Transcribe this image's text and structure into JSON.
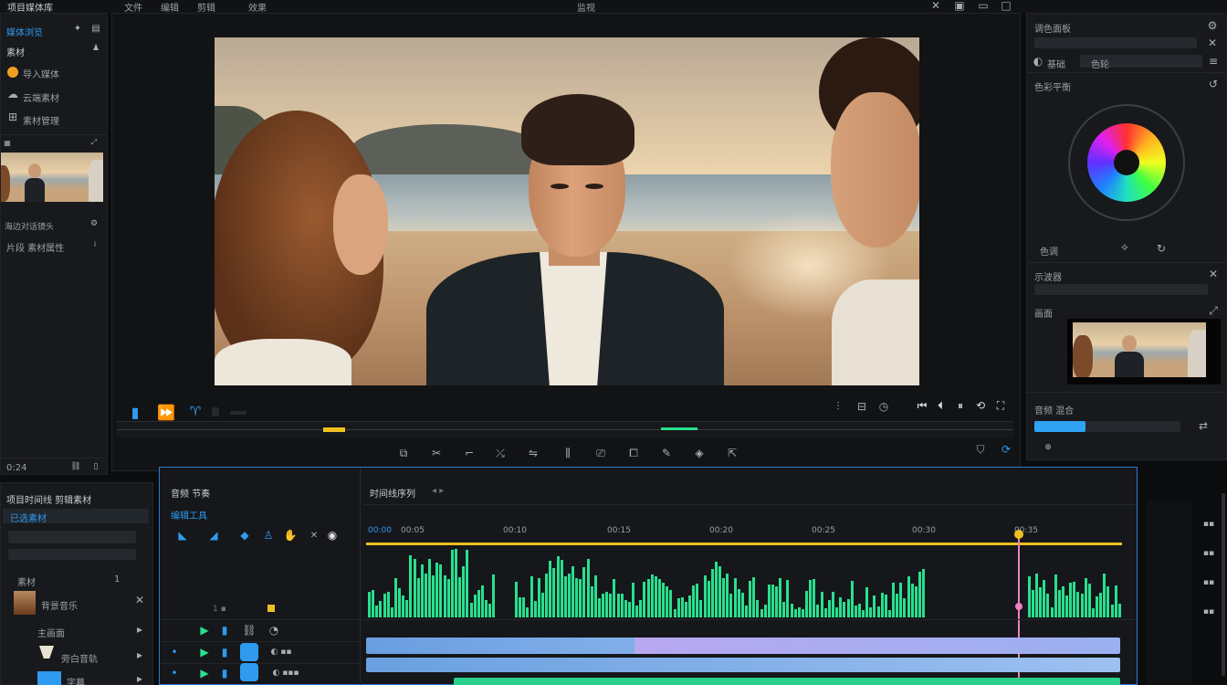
{
  "top_menu": {
    "left_title": "项目媒体库",
    "items": [
      "文件",
      "编辑",
      "剪辑",
      "效果"
    ],
    "center": "监视"
  },
  "left_panel": {
    "header": "媒体浏览",
    "tab": "素材",
    "items": [
      {
        "icon": "circle-icon",
        "color": "#f0a020",
        "label": "导入媒体"
      },
      {
        "icon": "cloud-icon",
        "label": "云端素材"
      },
      {
        "icon": "grid-icon",
        "label": "素材管理"
      }
    ],
    "clip_info": "海边对话镜头",
    "clip_sub": "片段 素材属性",
    "footer": "0:24"
  },
  "viewer": {
    "transport_left": [
      "播放",
      "快进",
      "标记"
    ],
    "tools": [
      "裁剪",
      "切割",
      "标记",
      "旋转",
      "分离",
      "变速",
      "定格",
      "镜像",
      "裁剪框",
      "冻结"
    ]
  },
  "right_panel": {
    "header": "调色面板",
    "tab1": "基础",
    "tab2": "色轮",
    "section_wheel": "色彩平衡",
    "wheel_label": "色调",
    "section_scope": "示波器",
    "section_scope2": "画面",
    "section_bottom": "音频 混合",
    "progress": 0.35
  },
  "project_panel": {
    "title": "项目时间线 剪辑素材",
    "sub": "已选素材",
    "rows": [
      "素材",
      "背景音乐",
      "主画面",
      "旁白音轨",
      "字幕"
    ]
  },
  "timeline": {
    "track_header": "音频 节奏",
    "tools_label": "编辑工具",
    "title": "时间线序列",
    "markers": [
      "00:00",
      "00:05",
      "00:10",
      "00:15",
      "00:20",
      "00:25",
      "00:30",
      "00:35"
    ],
    "colors": {
      "accent": "#2b7bd0",
      "wave": "#28e08e",
      "playhead": "#f080c0",
      "ruler": "#f0c020"
    }
  }
}
